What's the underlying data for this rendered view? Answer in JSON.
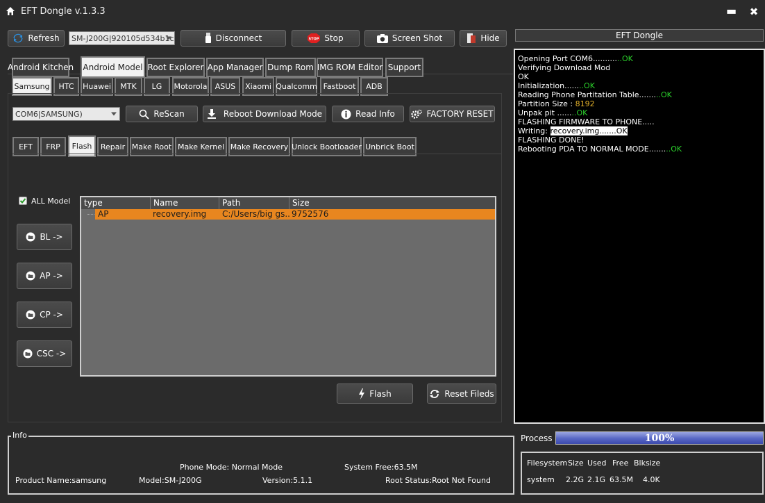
{
  "window": {
    "title": "EFT Dongle  v.1.3.3",
    "min": "▬",
    "close": "✖"
  },
  "toolbar": {
    "refresh": "Refresh",
    "device_combo": "SM-J200G|920105d534b1c",
    "disconnect": "Disconnect",
    "stop": "Stop",
    "stop_badge": "STOP",
    "screenshot": "Screen Shot",
    "hide": "Hide"
  },
  "main_tabs": [
    "Android Kitchen",
    "Android Model",
    "Root Explorer",
    "App Manager",
    "Dump Rom",
    "IMG ROM Editor",
    "Support"
  ],
  "brand_tabs": [
    "Samsung",
    "HTC",
    "Huawei",
    "MTK",
    "LG",
    "Motorola",
    "ASUS",
    "Xiaomi",
    "Qualcomm",
    "Fastboot",
    "ADB"
  ],
  "port": {
    "combo": "COM6|SAMSUNG)",
    "rescan": "ReScan",
    "reboot": "Reboot  Download Mode",
    "readinfo": "Read Info",
    "factory": "FACTORY RESET"
  },
  "sub_tabs": [
    "EFT",
    "FRP",
    "Flash",
    "Repair",
    "Make Root",
    "Make Kernel",
    "Make Recovery",
    "Unlock Bootloader",
    "Unbrick Boot"
  ],
  "flash": {
    "all_model": "ALL Model",
    "bl": "BL ->",
    "ap": "AP ->",
    "cp": "CP ->",
    "csc": "CSC ->",
    "columns": [
      "type",
      "Name",
      "Path",
      "Size"
    ],
    "rows": [
      {
        "type": "AP",
        "name": "recovery.img",
        "path": "C:/Users/big gs...",
        "size": "9752576"
      }
    ],
    "flash_btn": "Flash",
    "reset_btn": "Reset Fileds"
  },
  "console": {
    "header": "EFT Dongle",
    "lines": {
      "l1a": "Opening Port COM6..........",
      "l1b": "..OK",
      "l2": "Verifying Download Mod",
      "l3": "OK",
      "l4a": "Initialization......",
      "l4b": "..OK",
      "l5a": "Reading Phone Partitation Table.......",
      "l5b": "..OK",
      "l6a": "Partition Size : ",
      "l6b": "8192",
      "l7a": "Unpak pit ......",
      "l7b": "..OK",
      "l8": "FLASHING FIRMWARE TO PHONE.....",
      "l9a": "Writing: ",
      "l9b": "recovery.img.......OK",
      "l10": "FLASHING DONE!",
      "l11a": "Rebooting PDA TO NORMAL MODE.......",
      "l11b": "..OK"
    }
  },
  "info": {
    "label": "Info",
    "phone_mode": "Phone Mode: Normal Mode",
    "system_free": "System Free:63.5M",
    "product": "Product Name:samsung",
    "model": "Model:SM-J200G",
    "version": "Version:5.1.1",
    "root": "Root Status:Root Not Found"
  },
  "process": {
    "label": "Process",
    "percent": "100%",
    "progress": 1.0
  },
  "filesystem": {
    "headers": [
      "Filesystem",
      "Size",
      "Used",
      "Free",
      "Blksize"
    ],
    "row": [
      "system",
      "2.2G",
      "2.1G",
      "63.5M",
      "4.0K"
    ]
  },
  "colors": {
    "accent_row": "#e8861f",
    "ok": "#2bd12b",
    "progress": "#5766c4"
  }
}
